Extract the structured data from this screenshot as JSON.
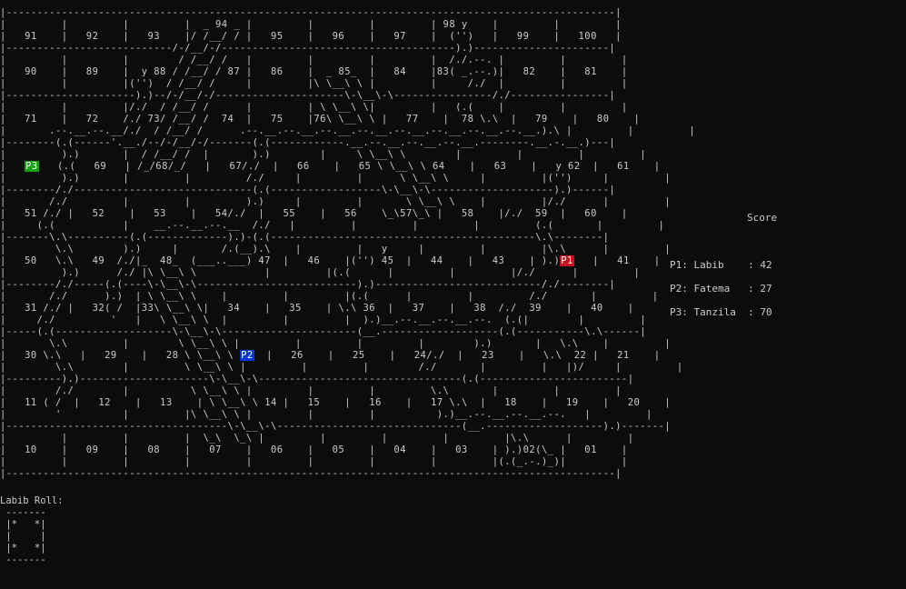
{
  "board": {
    "lines": [
      "|---------------------------------------------------------------------------------------------------|",
      "|         |         |         |  _ 94 _ |         |         |         | 98 y    |         |         |",
      "|   91    |   92    |   93    |/ /__/ / |   95    |   96    |   97    |  ('')   |   99    |   100   |",
      "|---------------------------/-/__/-/--------------------------------------).)----------------------|",
      "|         |         |        / /__/ /   |         |         |         |  /./.--. |         |         |",
      "|   90    |   89    |  y 88 / /__/ / 87 |   86    |  _ 85_  |   84    |83( _.--.)|   82    |   81    |",
      "|         |         |('')  / /__/ /     |         |\\ \\__\\ \\ |         |     /./  |         |         |",
      "|---------------------).)--/-/__/-/---------------------\\-\\__\\-\\----------------/./----------------|",
      "|         |         |/./  / /__/ /      |         | \\ \\__\\ \\|         |   (.(    |         |         |",
      "|   71    |   72    /./ 73/ /__/ /  74  |   75    |76\\ \\__\\ \\ |   77    |  78 \\.\\  |   79    |   80    |",
      "|       .--.__.--.__/./  / /__/ /      .--.__.--.__.--.__.--.__.--.__.--.__.--.__.--.__.).\\ |         |         |",
      "|--------(.(------'.__./--/-/__/-/-------(.(------------.__.--.__.--.__.--.__.--------.__.-.__.)---|",
      "|         ).)       |  / /__/ /  |       ).)        |     \\ \\__\\ \\        |         |         |         |",
      "|   P3   (.(   69   | /_/68/_/   |   67/./  |   66    |   65 \\ \\__\\ \\ 64    |   63    |   y 62  |   61    |",
      "|         ).)       |         |         /./     |         |      \\ \\__\\ \\     |         |('')     |         |",
      "|--------/./-----------------------------(.(------------------\\-\\__\\-\\--------------------).)------|",
      "|       /./         |         |         ).)     |         |       \\ \\__\\ \\    |         |/./      |         |",
      "|   51 /./ |   52    |   53    |   54/./  |   55    |   56    \\_\\57\\_\\ |   58    |/./  59  |   60    |",
      "|     (.(           |    __.--.__.--.__  /./   |         |         |         |         (.(       |         |",
      "|-------\\.\\----------(.(-------------).)-(.(-------------------------------------------\\.\\--------|",
      "|        \\.\\        ).)     |       /.(__).\\    |         |   y     |         |         |\\.\\      |         |",
      "|   50   \\.\\   49  /./|_  48_  (___..___) 47  |   46    |('') 45  |   44    |   43    | ).)P1   |   41    |",
      "|         ).)      /./ |\\ \\__\\ \\           |         |(.(      |         |         |/./      |         |",
      "|--------/./-----(.(----\\-\\__\\-\\--------------------------).)---------------------------/./--------|",
      "|       /./      ).)  | \\ \\__\\ \\    |         |         |(.(      |         |         /./       |         |",
      "|   31 /./ |   32( /  |33\\ \\__\\ \\|   34    |   35    | \\.\\ 36  |   37    |   38  /./  39    |   40    |",
      "|     /./         '   |   \\ \\__\\ \\  |         |         |  ).)__.--.__.--.__.--.  (.(|        |         |",
      "|-----(.(-------------------\\-\\__\\-\\----------------------(__.-------------------(.(-----------\\.\\------|",
      "|       \\.\\         |        \\ \\__\\ \\ |         |         |         |        ).)       |   \\.\\    |         |",
      "|   30 \\.\\   |   29    |   28 \\ \\__\\ \\ P2  |   26    |   25    |   24/./  |   23    |   \\.\\  22 |   21    |",
      "|        \\.\\        |         \\ \\__\\ \\ |         |         |        /./       |         |   |)/     |         |",
      "|---------).)---------------------\\-\\__\\-\\---------------------------------(.(------------------------|",
      "|        /./        |          \\ \\__\\ \\ |         |         |         \\.\\       |         |         |",
      "|   11 ( /  |   12    |   13    | \\ \\__\\ \\ 14 |   15    |   16    |   17 \\.\\  |   18    |   19    |   20    |",
      "|        '          |         |\\ \\__\\ \\ |         |         |          ).)__.--.__.--.__.--.   |         |",
      "|------------------------------------\\-\\__\\-\\------------------------------(__.-------------------).)-------|",
      "|         |         |         |  \\_\\  \\_\\ |         |         |         |         |\\.\\      |         |",
      "|   10    |   09    |   08    |   07    |   06    |   05    |   04    |   03    | ).)02(\\_ |   01    |",
      "|         |         |         |         |         |         |         |         |(.(_.-.)_)|         |",
      "|---------------------------------------------------------------------------------------------------|"
    ],
    "tokens": [
      {
        "line": 13,
        "text": "P3",
        "color": "#13a10e"
      },
      {
        "line": 21,
        "text": "P1",
        "color": "#c50f1f"
      },
      {
        "line": 29,
        "text": "P2",
        "color": "#0037da"
      }
    ]
  },
  "score": {
    "title": "Score",
    "rows": [
      "P1: Labib    : 42",
      "P2: Fatema   : 27",
      "P3: Tanzila  : 70"
    ]
  },
  "roll": {
    "label": "Labib Roll:",
    "die": [
      " -------",
      " |*   *|",
      " |     |",
      " |*   *|",
      " -------"
    ]
  }
}
